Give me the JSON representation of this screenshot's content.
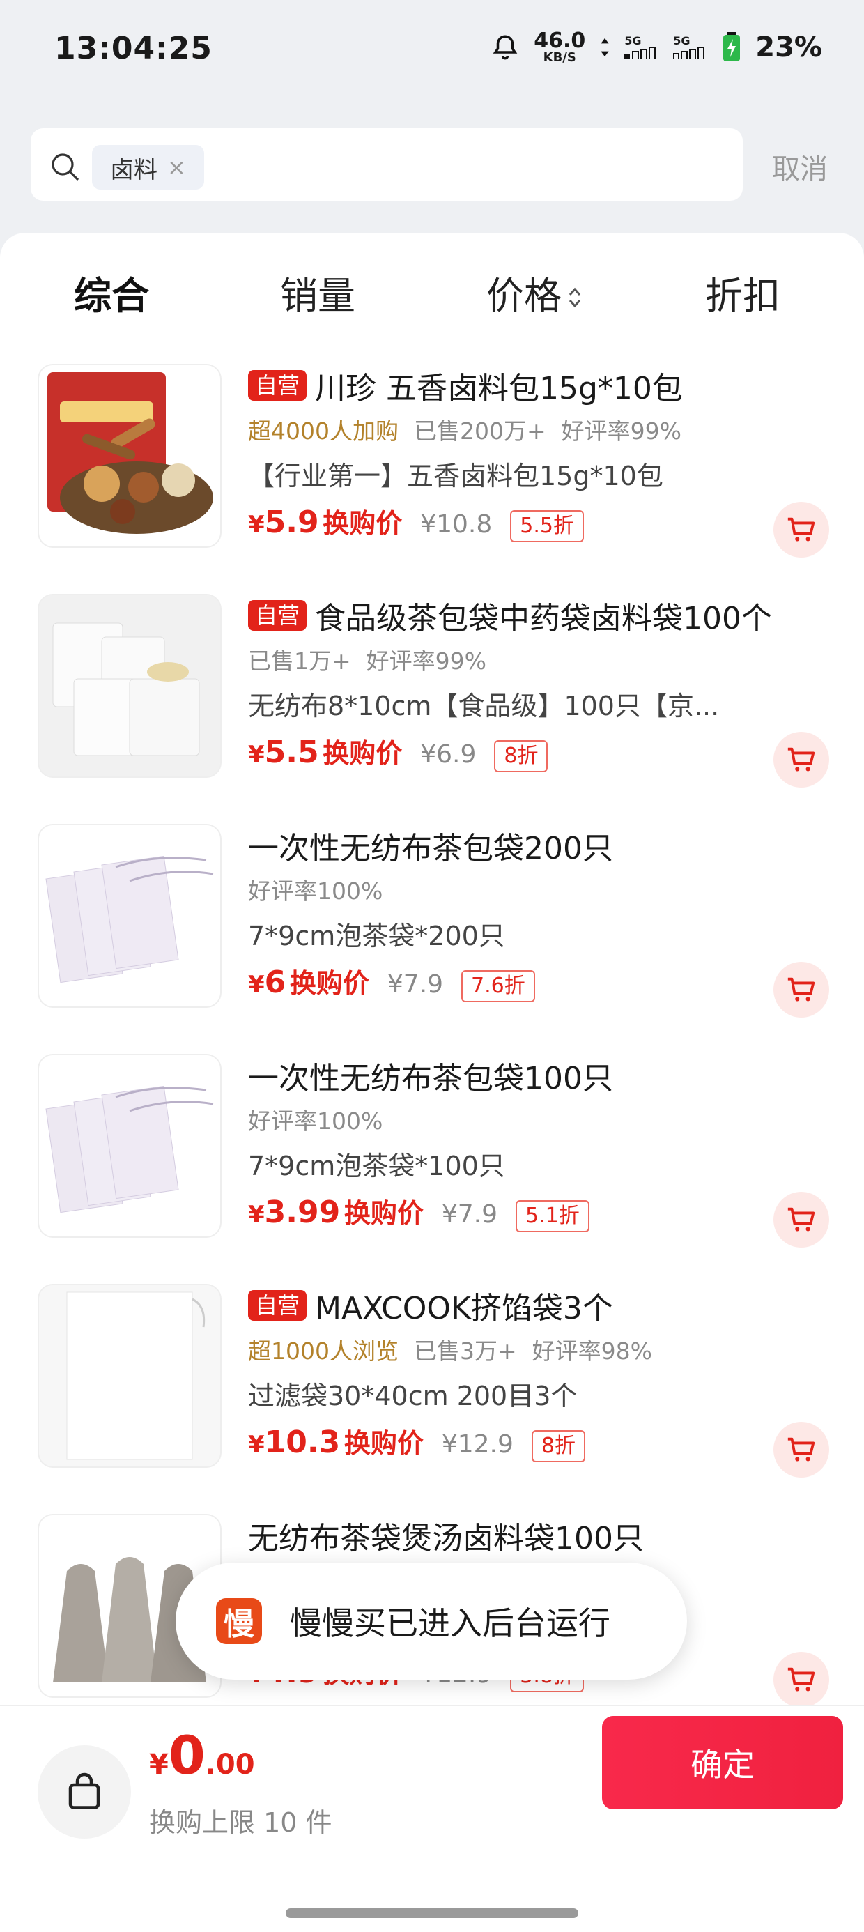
{
  "status": {
    "time": "13:04:25",
    "speed_value": "46.0",
    "speed_unit": "KB/S",
    "sig1": "5G",
    "sig2": "5G",
    "battery": "23%"
  },
  "search": {
    "keyword": "卤料",
    "cancel": "取消"
  },
  "sort": {
    "tabs": [
      "综合",
      "销量",
      "价格",
      "折扣"
    ]
  },
  "products": [
    {
      "badge": "自营",
      "title": "川珍 五香卤料包15g*10包",
      "promo": "超4000人加购",
      "sold": "已售200万+",
      "rating": "好评率99%",
      "desc": "【行业第一】五香卤料包15g*10包",
      "currency": "¥",
      "price": "5.9",
      "price_tag": "换购价",
      "orig": "¥10.8",
      "discount": "5.5折"
    },
    {
      "badge": "自营",
      "title": "食品级茶包袋中药袋卤料袋100个",
      "promo": "",
      "sold": "已售1万+",
      "rating": "好评率99%",
      "desc": "无纺布8*10cm【食品级】100只【京...",
      "currency": "¥",
      "price": "5.5",
      "price_tag": "换购价",
      "orig": "¥6.9",
      "discount": "8折"
    },
    {
      "badge": "",
      "title": "一次性无纺布茶包袋200只",
      "promo": "",
      "sold": "",
      "rating": "好评率100%",
      "desc": "7*9cm泡茶袋*200只",
      "currency": "¥",
      "price": "6",
      "price_tag": "换购价",
      "orig": "¥7.9",
      "discount": "7.6折"
    },
    {
      "badge": "",
      "title": "一次性无纺布茶包袋100只",
      "promo": "",
      "sold": "",
      "rating": "好评率100%",
      "desc": "7*9cm泡茶袋*100只",
      "currency": "¥",
      "price": "3.99",
      "price_tag": "换购价",
      "orig": "¥7.9",
      "discount": "5.1折"
    },
    {
      "badge": "自营",
      "title": "MAXCOOK挤馅袋3个",
      "promo": "超1000人浏览",
      "sold": "已售3万+",
      "rating": "好评率98%",
      "desc": "过滤袋30*40cm 200目3个",
      "currency": "¥",
      "price": "10.3",
      "price_tag": "换购价",
      "orig": "¥12.9",
      "discount": "8折"
    },
    {
      "badge": "",
      "title": "无纺布茶袋煲汤卤料袋100只",
      "promo": "",
      "sold": "",
      "rating": "",
      "desc": "",
      "currency": "¥",
      "price": "4.9",
      "price_tag": "换购价",
      "orig": "¥12.9",
      "discount": "3.8折"
    }
  ],
  "toast": {
    "icon_char": "慢",
    "text": "慢慢买已进入后台运行"
  },
  "bottom": {
    "currency": "¥",
    "total_int": "0",
    "total_dec": ".00",
    "limit": "换购上限 10 件",
    "confirm": "确定"
  },
  "colors": {
    "accent": "#e2231a",
    "promo": "#b3822b",
    "confirm_bg": "#f8294b"
  }
}
